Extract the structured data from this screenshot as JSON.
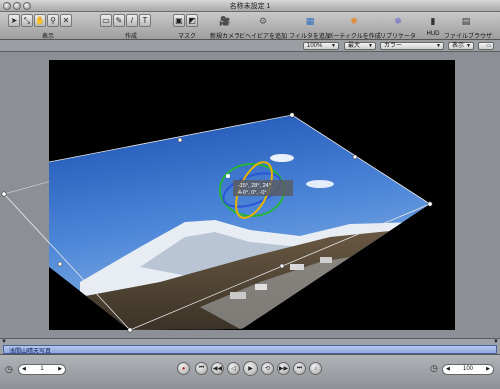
{
  "window": {
    "title": "名称未設定 1"
  },
  "toolbar": {
    "groups": [
      {
        "label": "表示"
      },
      {
        "label": "作成"
      },
      {
        "label": "マスク"
      },
      {
        "label": "新規カメラ"
      },
      {
        "label": "ビヘイビアを追加"
      },
      {
        "label": "フィルタを追加"
      },
      {
        "label": "パーティクルを作成"
      },
      {
        "label": "リプリケータ"
      },
      {
        "label": "HUD"
      },
      {
        "label": "ファイルブラウザ"
      }
    ]
  },
  "options": {
    "zoom": "100%",
    "resolution": "最大",
    "color": "カラー",
    "view": "表示"
  },
  "hud": {
    "line1": "-15°, 28°, 24°",
    "line2": "4-0°, 0°, -0°"
  },
  "timeline": {
    "track_label": "浅間山晴天写真"
  },
  "transport": {
    "frame": "1",
    "zoom": "100"
  },
  "colors": {
    "track": "#8ea8e0",
    "canvas_bg": "#000000",
    "toolbar_bg": "#b4b4b4"
  }
}
